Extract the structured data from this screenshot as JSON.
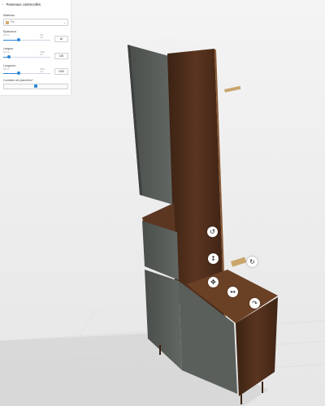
{
  "panel": {
    "title": "Panneaux contrecollés",
    "back_icon": "chevron-left-icon",
    "material": {
      "label": "Matériau",
      "value": "Pin",
      "swatch_color": "#d7a96a"
    },
    "thickness": {
      "label": "Épaisseur",
      "min": "18 mm",
      "max": "100 mm",
      "value": "60",
      "fraction": 0.33
    },
    "width": {
      "label": "Largeur",
      "min": "30 mm",
      "max": "1200 mm",
      "value": "155",
      "fraction": 0.12
    },
    "length": {
      "label": "Longueur",
      "min": "30 mm",
      "max": "3000 mm",
      "value": "1000",
      "fraction": 0.32
    },
    "flatten": {
      "label": "Combien de planches?",
      "fraction": 0.5
    }
  },
  "colors": {
    "accent": "#2c86d8",
    "wood": "#4a2b18",
    "door": "#555a57"
  },
  "gizmo_icons": [
    "rotate-icon",
    "move-vertical-icon",
    "move-all-icon",
    "move-horizontal-icon",
    "rotate-icon",
    "rotate-icon"
  ]
}
